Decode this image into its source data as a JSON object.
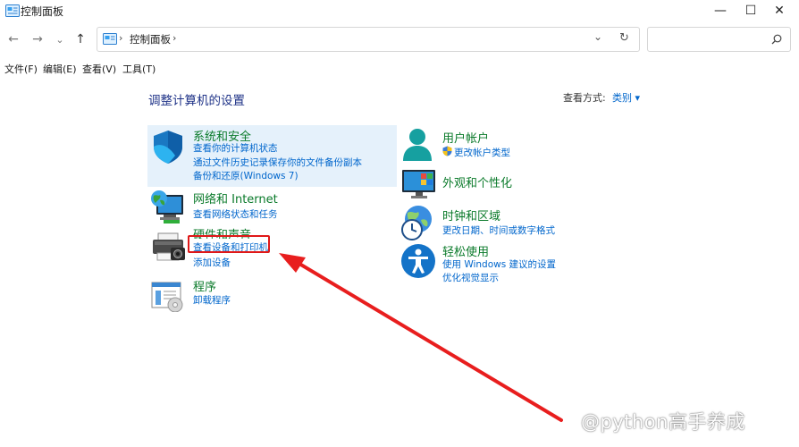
{
  "window": {
    "title": "控制面板",
    "minimize_glyph": "—",
    "maximize_glyph": "☐",
    "close_glyph": "✕"
  },
  "navigation": {
    "back": "←",
    "forward": "→",
    "recent": "⌄",
    "up": "↑",
    "breadcrumb": [
      "控制面板"
    ],
    "separator": "›",
    "dropdown_glyph": "⌄",
    "refresh_glyph": "↻",
    "search_placeholder": "",
    "search_glyph": "⌕"
  },
  "menubar": {
    "items": [
      "文件(F)",
      "编辑(E)",
      "查看(V)",
      "工具(T)"
    ]
  },
  "content": {
    "heading": "调整计算机的设置",
    "view_by_label": "查看方式:",
    "view_by_value": "类别 ▾",
    "categories_left": [
      {
        "title": "系统和安全",
        "icon": "shield-icon",
        "links": [
          "查看你的计算机状态",
          "通过文件历史记录保存你的文件备份副本",
          "备份和还原(Windows 7)"
        ]
      },
      {
        "title": "网络和 Internet",
        "icon": "network-globe-icon",
        "links": [
          "查看网络状态和任务"
        ]
      },
      {
        "title": "硬件和声音",
        "icon": "printer-icon",
        "links": [
          "查看设备和打印机",
          "添加设备"
        ]
      },
      {
        "title": "程序",
        "icon": "programs-icon",
        "links": [
          "卸载程序"
        ]
      }
    ],
    "categories_right": [
      {
        "title": "用户帐户",
        "icon": "user-icon",
        "links": [
          "更改帐户类型"
        ]
      },
      {
        "title": "外观和个性化",
        "icon": "monitor-icon",
        "links": []
      },
      {
        "title": "时钟和区域",
        "icon": "clock-globe-icon",
        "links": [
          "更改日期、时间或数字格式"
        ]
      },
      {
        "title": "轻松使用",
        "icon": "accessibility-icon",
        "links": [
          "使用 Windows 建议的设置",
          "优化视觉显示"
        ]
      }
    ]
  },
  "annotations": {
    "highlight_color": "#e01818",
    "watermark": "@python高手养成"
  },
  "colors": {
    "link": "#0066cc",
    "category_title": "#0a7a2a",
    "heading": "#1e3287",
    "hover_bg": "#e5f1fb"
  }
}
